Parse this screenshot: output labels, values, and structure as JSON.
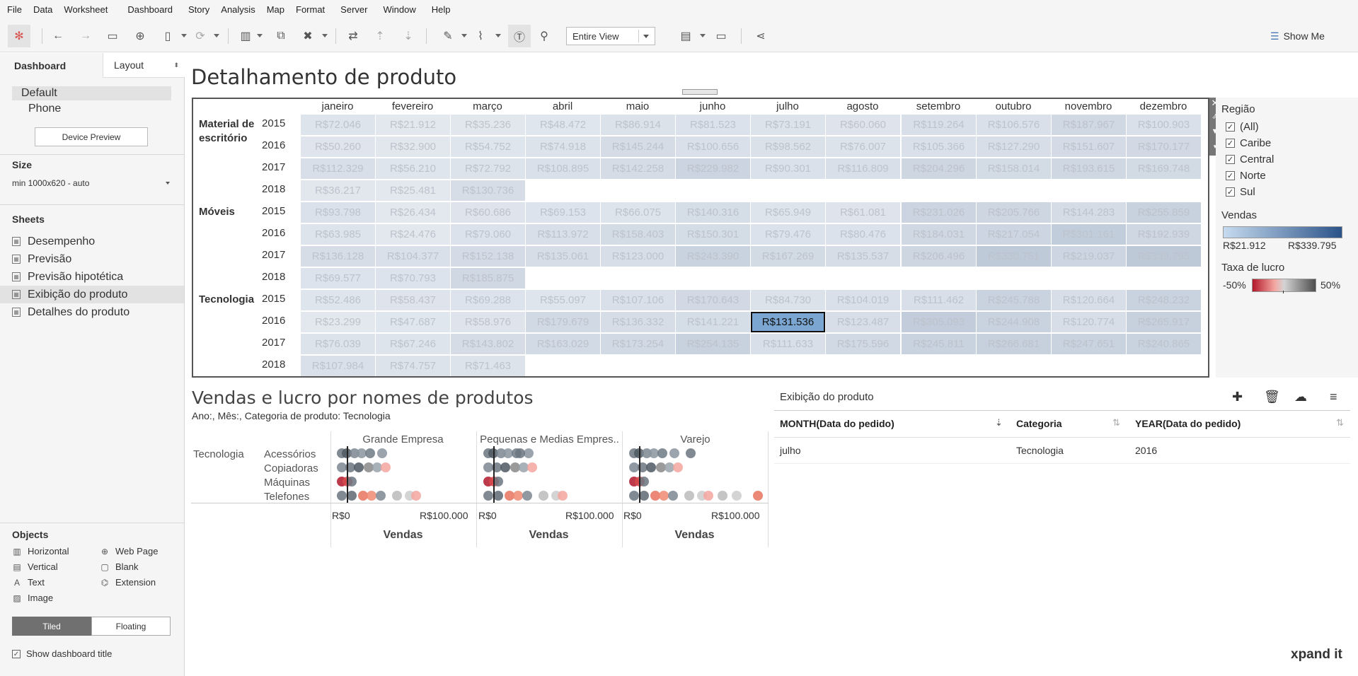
{
  "menu": [
    "File",
    "Data",
    "Worksheet",
    "Dashboard",
    "Story",
    "Analysis",
    "Map",
    "Format",
    "Server",
    "Window",
    "Help"
  ],
  "toolbar": {
    "view": "Entire View",
    "show_me": "Show Me"
  },
  "leftpanel": {
    "tab_dashboard": "Dashboard",
    "tab_layout": "Layout",
    "device_default": "Default",
    "device_phone": "Phone",
    "device_preview": "Device Preview",
    "size_title": "Size",
    "size_value": "min 1000x620 - auto",
    "sheets_title": "Sheets",
    "sheets": [
      "Desempenho",
      "Previsão",
      "Previsão hipotética",
      "Exibição do produto",
      "Detalhes do produto"
    ],
    "objects_title": "Objects",
    "objects": [
      "Horizontal",
      "Web Page",
      "Vertical",
      "Blank",
      "Text",
      "Extension",
      "Image"
    ],
    "tiled": "Tiled",
    "floating": "Floating",
    "show_title": "Show dashboard title"
  },
  "dashboard": {
    "title": "Detalhamento de produto"
  },
  "heatmap": {
    "months": [
      "janeiro",
      "fevereiro",
      "março",
      "abril",
      "maio",
      "junho",
      "julho",
      "agosto",
      "setembro",
      "outubro",
      "novembro",
      "dezembro"
    ],
    "categories": [
      "Material de escritório",
      "Móveis",
      "Tecnologia"
    ],
    "years": [
      "2015",
      "2016",
      "2017",
      "2018"
    ],
    "rows": [
      [
        "R$72.046",
        "R$21.912",
        "R$35.236",
        "R$48.472",
        "R$86.914",
        "R$81.523",
        "R$73.191",
        "R$60.060",
        "R$119.264",
        "R$106.576",
        "R$187.967",
        "R$100.903"
      ],
      [
        "R$50.260",
        "R$32.900",
        "R$54.752",
        "R$74.918",
        "R$145.244",
        "R$100.656",
        "R$98.562",
        "R$76.007",
        "R$105.366",
        "R$127.290",
        "R$151.607",
        "R$170.177"
      ],
      [
        "R$112.329",
        "R$56.210",
        "R$72.792",
        "R$108.895",
        "R$142.258",
        "R$229.982",
        "R$90.301",
        "R$116.809",
        "R$204.296",
        "R$158.014",
        "R$193.615",
        "R$169.748"
      ],
      [
        "R$36.217",
        "R$25.481",
        "R$130.736"
      ],
      [
        "R$93.798",
        "R$26.434",
        "R$60.686",
        "R$69.153",
        "R$66.075",
        "R$140.316",
        "R$65.949",
        "R$61.081",
        "R$231.026",
        "R$205.766",
        "R$144.283",
        "R$255.859"
      ],
      [
        "R$63.985",
        "R$24.476",
        "R$79.060",
        "R$113.972",
        "R$158.403",
        "R$150.301",
        "R$79.476",
        "R$80.476",
        "R$184.031",
        "R$217.054",
        "R$301.161",
        "R$192.939"
      ],
      [
        "R$136.128",
        "R$104.377",
        "R$152.138",
        "R$135.061",
        "R$123.000",
        "R$243.390",
        "R$167.269",
        "R$135.537",
        "R$206.496",
        "R$330.751",
        "R$219.037",
        "R$339.795"
      ],
      [
        "R$69.577",
        "R$70.793",
        "R$185.875"
      ],
      [
        "R$52.486",
        "R$58.437",
        "R$69.288",
        "R$55.097",
        "R$107.106",
        "R$170.643",
        "R$84.730",
        "R$104.019",
        "R$111.462",
        "R$245.788",
        "R$120.664",
        "R$248.232"
      ],
      [
        "R$23.299",
        "R$47.687",
        "R$58.976",
        "R$179.679",
        "R$136.332",
        "R$141.221",
        "R$131.536",
        "R$123.487",
        "R$305.093",
        "R$244.908",
        "R$120.774",
        "R$265.917"
      ],
      [
        "R$76.039",
        "R$67.246",
        "R$143.802",
        "R$163.029",
        "R$173.254",
        "R$254.135",
        "R$111.633",
        "R$175.596",
        "R$245.811",
        "R$266.681",
        "R$247.651",
        "R$240.865"
      ],
      [
        "R$107.984",
        "R$74.757",
        "R$71.463"
      ]
    ],
    "intensity": [
      [
        0.13,
        0.0,
        0.04,
        0.08,
        0.2,
        0.19,
        0.16,
        0.12,
        0.3,
        0.27,
        0.52,
        0.25
      ],
      [
        0.09,
        0.03,
        0.1,
        0.17,
        0.39,
        0.25,
        0.24,
        0.17,
        0.26,
        0.33,
        0.41,
        0.47
      ],
      [
        0.28,
        0.11,
        0.16,
        0.27,
        0.38,
        0.65,
        0.21,
        0.29,
        0.57,
        0.43,
        0.54,
        0.46
      ],
      [
        0.04,
        0.01,
        0.34
      ],
      [
        0.22,
        0.01,
        0.12,
        0.15,
        0.14,
        0.37,
        0.14,
        0.12,
        0.66,
        0.58,
        0.38,
        0.74
      ],
      [
        0.13,
        0.01,
        0.18,
        0.29,
        0.43,
        0.4,
        0.18,
        0.18,
        0.51,
        0.61,
        0.88,
        0.54
      ],
      [
        0.36,
        0.26,
        0.41,
        0.35,
        0.32,
        0.69,
        0.46,
        0.35,
        0.58,
        0.97,
        0.62,
        1.0
      ],
      [
        0.15,
        0.15,
        0.51
      ],
      [
        0.1,
        0.12,
        0.15,
        0.11,
        0.27,
        0.47,
        0.2,
        0.26,
        0.28,
        0.7,
        0.31,
        0.71
      ],
      [
        0.0,
        0.08,
        0.12,
        0.49,
        0.36,
        0.37,
        0.34,
        0.32,
        0.89,
        0.7,
        0.31,
        0.77
      ],
      [
        0.17,
        0.14,
        0.39,
        0.45,
        0.48,
        0.73,
        0.28,
        0.48,
        0.7,
        0.77,
        0.71,
        0.69
      ],
      [
        0.27,
        0.17,
        0.16
      ]
    ],
    "selected": {
      "row": 9,
      "col": 6
    }
  },
  "legends": {
    "region_title": "Região",
    "regions": [
      "(All)",
      "Caribe",
      "Central",
      "Norte",
      "Sul"
    ],
    "sales_title": "Vendas",
    "sales_min": "R$21.912",
    "sales_max": "R$339.795",
    "profit_title": "Taxa de lucro",
    "profit_min": "-50%",
    "profit_max": "50%",
    "colors": {
      "sales_low": "#c6dbef",
      "sales_high": "#2b5389",
      "profit_neg": "#b2182b",
      "profit_mid": "#d4d4d4",
      "profit_pos": "#4d4d4d"
    }
  },
  "bottom_chart": {
    "title": "Vendas e lucro por nomes de produtos",
    "subtitle": "Ano:, Mês:, Categoria de produto: Tecnologia",
    "category": "Tecnologia",
    "segments": [
      "Grande Empresa",
      "Pequenas e Medias Empres..",
      "Varejo"
    ],
    "products": [
      "Acessórios",
      "Copiadoras",
      "Máquinas",
      "Telefones"
    ],
    "axis_min": "R$0",
    "axis_max": "R$100.000",
    "axis_title": "Vendas"
  },
  "table": {
    "title": "Exibição do produto",
    "headers": [
      "MONTH(Data do pedido)",
      "Categoria",
      "YEAR(Data do pedido)"
    ],
    "row": [
      "julho",
      "Tecnologia",
      "2016"
    ]
  },
  "brand": "xpand it"
}
